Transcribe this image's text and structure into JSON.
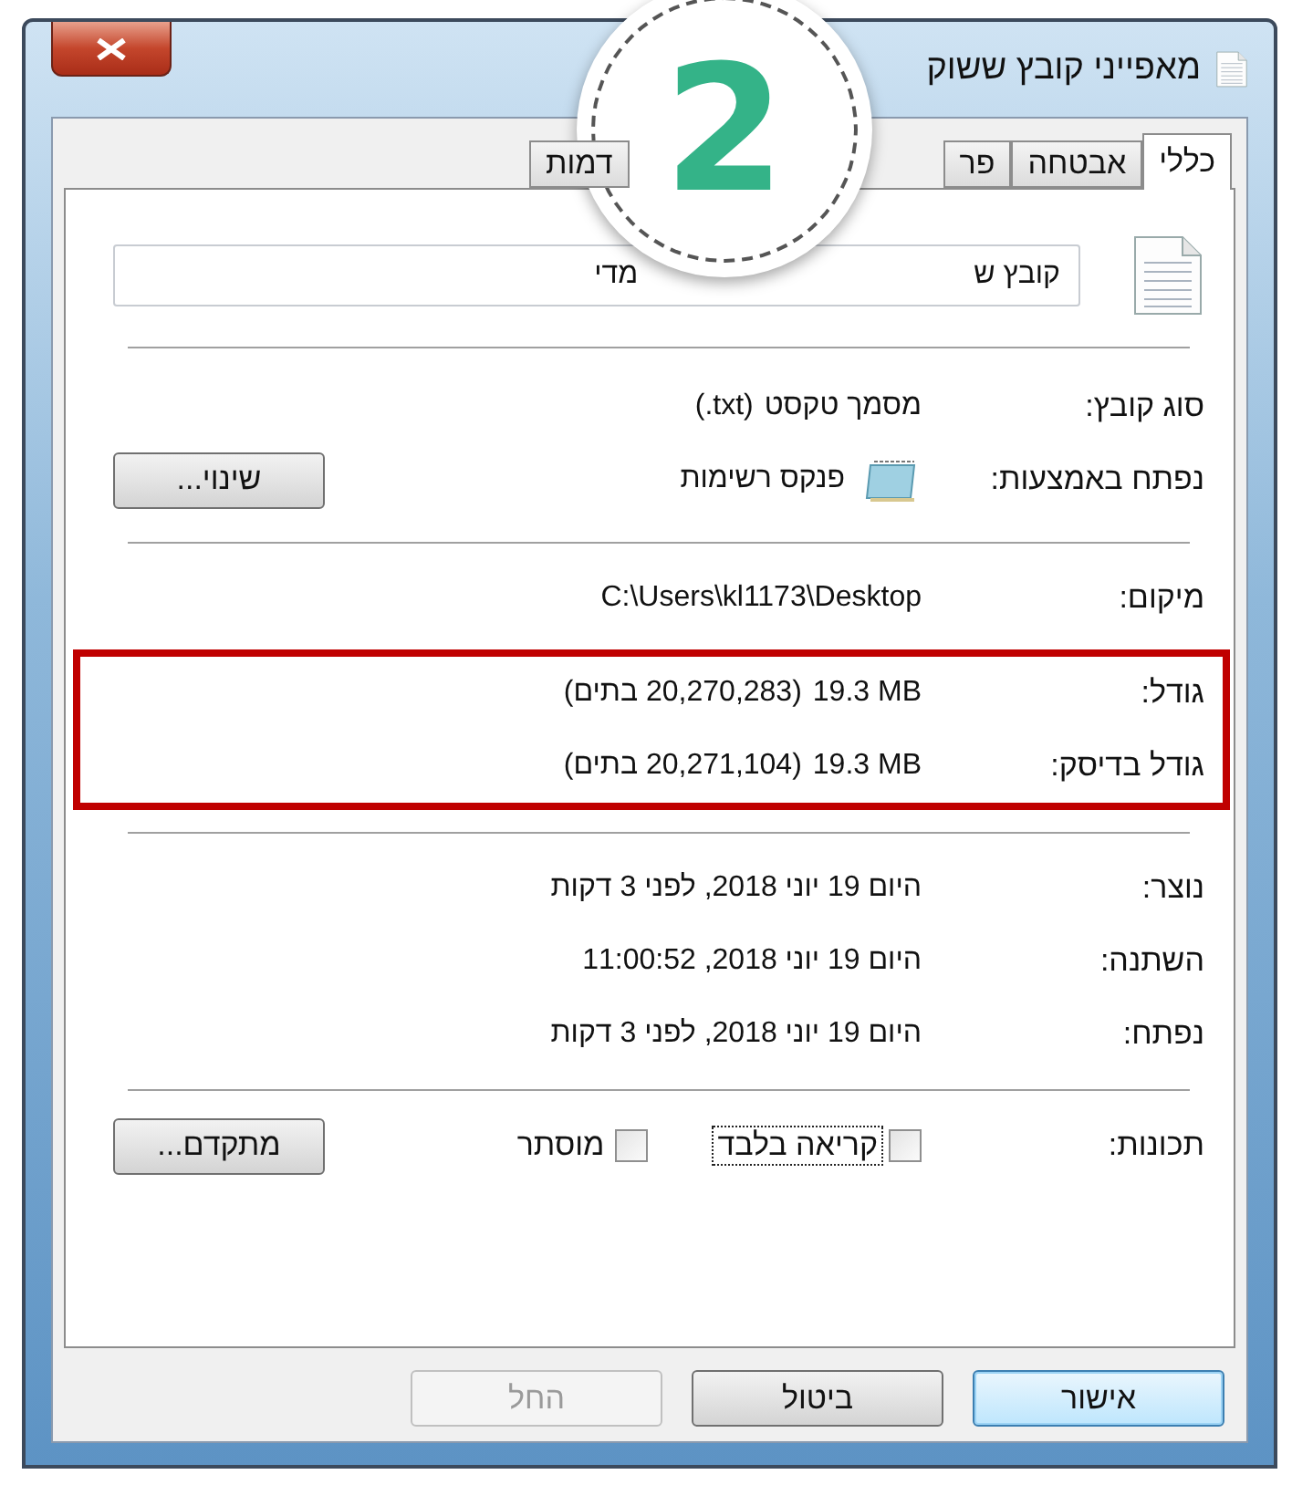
{
  "window": {
    "title": "מאפייני קובץ ששוק"
  },
  "badge": {
    "text": "2"
  },
  "tabs": [
    {
      "label": "כללי",
      "selected": true
    },
    {
      "label": "אבטחה",
      "selected": false
    },
    {
      "label": "פר",
      "selected": false
    },
    {
      "label": "דמות",
      "selected": false
    }
  ],
  "name_field": {
    "value_parts": [
      "קובץ ש",
      "מדי"
    ]
  },
  "type_rows": [
    {
      "label": "סוג קובץ:",
      "value": "מסמך טקסט",
      "ltr_part": "(.txt)"
    }
  ],
  "opens_with": {
    "label": "נפתח באמצעות:",
    "value": "פנקס רשימות",
    "button": "שינוי..."
  },
  "location": {
    "label": "מיקום:",
    "value": "C:\\Users\\kl1173\\Desktop"
  },
  "highlighted_rows": [
    {
      "label": "גודל:",
      "ltr_part": "19.3 MB",
      "value": "(20,270,283 בתים)"
    },
    {
      "label": "גודל בדיסק:",
      "ltr_part": "19.3 MB",
      "value": "(20,271,104 בתים)"
    }
  ],
  "dates": [
    {
      "label": "נוצר:",
      "value": "היום 19 יוני 2018, לפני 3 דקות"
    },
    {
      "label": "השתנה:",
      "value": "היום 19 יוני 2018, 11:00:52"
    },
    {
      "label": "נפתח:",
      "value": "היום 19 יוני 2018, לפני 3 דקות"
    }
  ],
  "attributes": {
    "label": "תכונות:",
    "options": [
      {
        "label": "קריאה בלבד",
        "checked": false,
        "focused": true
      },
      {
        "label": "מוסתר",
        "checked": false,
        "focused": false
      }
    ],
    "button": "מתקדם..."
  },
  "buttons": [
    {
      "label": "אישור",
      "default": true,
      "disabled": false
    },
    {
      "label": "ביטול",
      "default": false,
      "disabled": false
    },
    {
      "label": "החל",
      "default": false,
      "disabled": true
    }
  ]
}
